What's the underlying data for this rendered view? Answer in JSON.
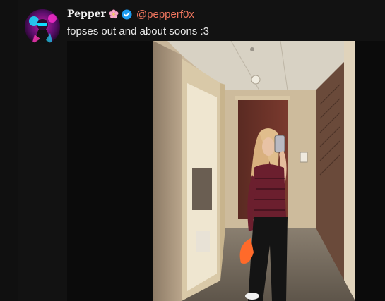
{
  "post": {
    "author": {
      "display_name": "Pepper",
      "handle": "@pepperf0x",
      "verified": true,
      "name_emoji": "cherry-blossom-icon"
    },
    "text": "fopses out and about soons :3",
    "colors": {
      "background": "#121212",
      "handle": "#f0765f",
      "verified": "#1d9bf0",
      "text": "#e9e9e9"
    }
  }
}
